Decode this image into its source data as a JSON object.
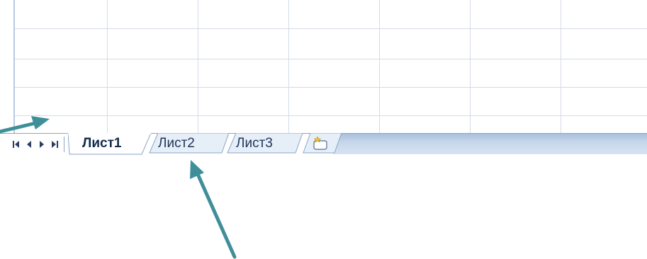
{
  "sheet_tabs": [
    {
      "label": "Лист1",
      "active": true
    },
    {
      "label": "Лист2",
      "active": false
    },
    {
      "label": "Лист3",
      "active": false
    }
  ],
  "navigation": {
    "first_icon": "first-sheet-icon",
    "prev_icon": "previous-sheet-icon",
    "next_icon": "next-sheet-icon",
    "last_icon": "last-sheet-icon"
  },
  "insert_sheet_icon": "insert-sheet-icon",
  "colors": {
    "arrow": "#3f8f99",
    "tab_text": "#21365a",
    "tab_bar": "#c6d6ea",
    "gridline": "#d4dce6"
  }
}
